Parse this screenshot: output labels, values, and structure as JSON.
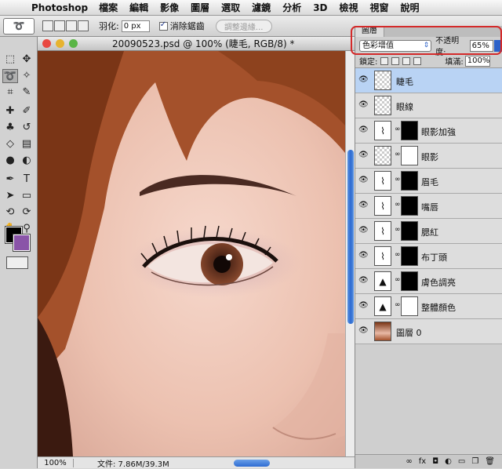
{
  "menubar": {
    "app_name": "Photoshop",
    "items": [
      "檔案",
      "編輯",
      "影像",
      "圖層",
      "選取",
      "濾鏡",
      "分析",
      "3D",
      "檢視",
      "視窗",
      "說明"
    ]
  },
  "options": {
    "feather_label": "羽化:",
    "feather_value": "0 px",
    "antialias_label": "消除鋸齒",
    "refine_edge_label": "調整邊緣..."
  },
  "document": {
    "title": "20090523.psd @ 100% (睫毛, RGB/8) *",
    "zoom": "100%",
    "doc_info": "文件: 7.86M/39.3M"
  },
  "colors": {
    "foreground": "#000000",
    "background": "#8a54a8",
    "highlight": "#d42a2a"
  },
  "layers_panel": {
    "tab_label": "圖層",
    "blend_mode": "色彩增值",
    "opacity_label": "不透明度:",
    "opacity_value": "65%",
    "lock_label": "鎖定:",
    "fill_label": "填滿:",
    "fill_value": "100%",
    "layers": [
      {
        "name": "睫毛",
        "kind": "pixel",
        "selected": true
      },
      {
        "name": "眼線",
        "kind": "pixel",
        "selected": false
      },
      {
        "name": "眼影加強",
        "kind": "curves",
        "mask": "black",
        "selected": false
      },
      {
        "name": "眼影",
        "kind": "pixel",
        "mask": "white",
        "selected": false
      },
      {
        "name": "眉毛",
        "kind": "curves",
        "mask": "black",
        "selected": false
      },
      {
        "name": "嘴唇",
        "kind": "curves",
        "mask": "black",
        "selected": false
      },
      {
        "name": "腮紅",
        "kind": "curves",
        "mask": "black",
        "selected": false
      },
      {
        "name": "布丁頭",
        "kind": "curves",
        "mask": "black",
        "selected": false
      },
      {
        "name": "膚色調亮",
        "kind": "levels",
        "mask": "black",
        "selected": false
      },
      {
        "name": "整體顏色",
        "kind": "levels",
        "mask": "white",
        "selected": false
      },
      {
        "name": "圖層 0",
        "kind": "photo",
        "selected": false
      }
    ]
  }
}
